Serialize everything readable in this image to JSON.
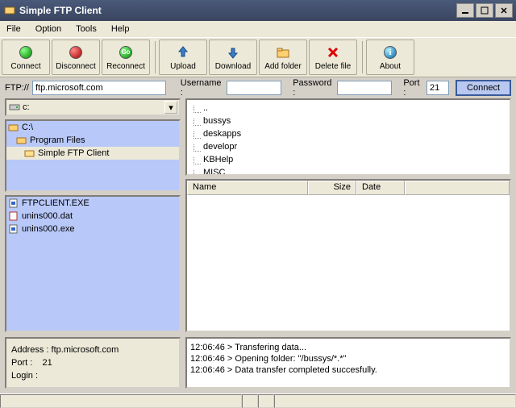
{
  "window": {
    "title": "Simple FTP Client"
  },
  "menu": {
    "file": "File",
    "option": "Option",
    "tools": "Tools",
    "help": "Help"
  },
  "toolbar": {
    "connect": "Connect",
    "disconnect": "Disconnect",
    "reconnect": "Reconnect",
    "upload": "Upload",
    "download": "Download",
    "addfolder": "Add folder",
    "deletefile": "Delete file",
    "about": "About"
  },
  "conn": {
    "ftp_label": "FTP://",
    "host": "ftp.microsoft.com",
    "user_label": "Username :",
    "user": "",
    "pass_label": "Password :",
    "pass": "",
    "port_label": "Port :",
    "port": "21",
    "connect_btn": "Connect"
  },
  "drive": {
    "selected": "c:"
  },
  "folders": {
    "a": "C:\\",
    "b": "Program Files",
    "c": "Simple FTP Client"
  },
  "files": {
    "a": "FTPCLIENT.EXE",
    "b": "unins000.dat",
    "c": "unins000.exe"
  },
  "remote": {
    "up": "..",
    "a": "bussys",
    "b": "deskapps",
    "c": "developr",
    "d": "KBHelp",
    "e": "MISC"
  },
  "table": {
    "name": "Name",
    "size": "Size",
    "date": "Date"
  },
  "info": {
    "addr_label": "Address :",
    "addr": "ftp.microsoft.com",
    "port_label": "Port :",
    "port": "21",
    "login_label": "Login :",
    "login": ""
  },
  "log": {
    "a": "12:06:46 > Transfering data...",
    "b": "12:06:46 > Opening folder: \"/bussys/*.*\"",
    "c": "12:06:46 > Data transfer completed succesfully."
  }
}
